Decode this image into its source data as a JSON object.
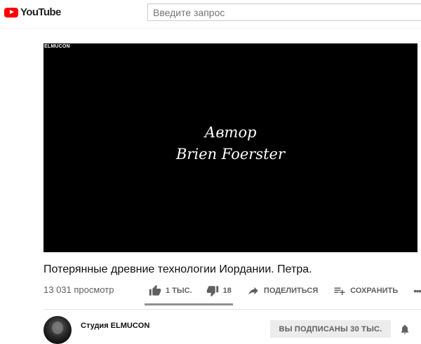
{
  "header": {
    "logo_text": "YouTube",
    "search_placeholder": "Введите запрос"
  },
  "player": {
    "watermark": "ELMUCON",
    "overlay_line1": "Автор",
    "overlay_line2": "Brien Foerster",
    "background_color": "#000000"
  },
  "video": {
    "title": "Потерянные древние технологии Иордании. Петра.",
    "views": "13 031 просмотр"
  },
  "actions": {
    "like_count": "1 ТЫС.",
    "dislike_count": "18",
    "share_label": "ПОДЕЛИТЬСЯ",
    "save_label": "СОХРАНИТЬ",
    "more_label": "•••",
    "like_ratio": 0.98
  },
  "channel": {
    "name": "Студия ELMUCON",
    "subscribe_label": "ВЫ ПОДПИСАНЫ  30 ТЫС."
  },
  "colors": {
    "brand_red": "#ff0000",
    "secondary_text": "#606060",
    "subscribe_bg": "#ececec"
  },
  "icons": [
    "youtube-logo-icon",
    "thumb-up-icon",
    "thumb-down-icon",
    "share-icon",
    "playlist-add-icon",
    "more-icon",
    "bell-icon"
  ]
}
